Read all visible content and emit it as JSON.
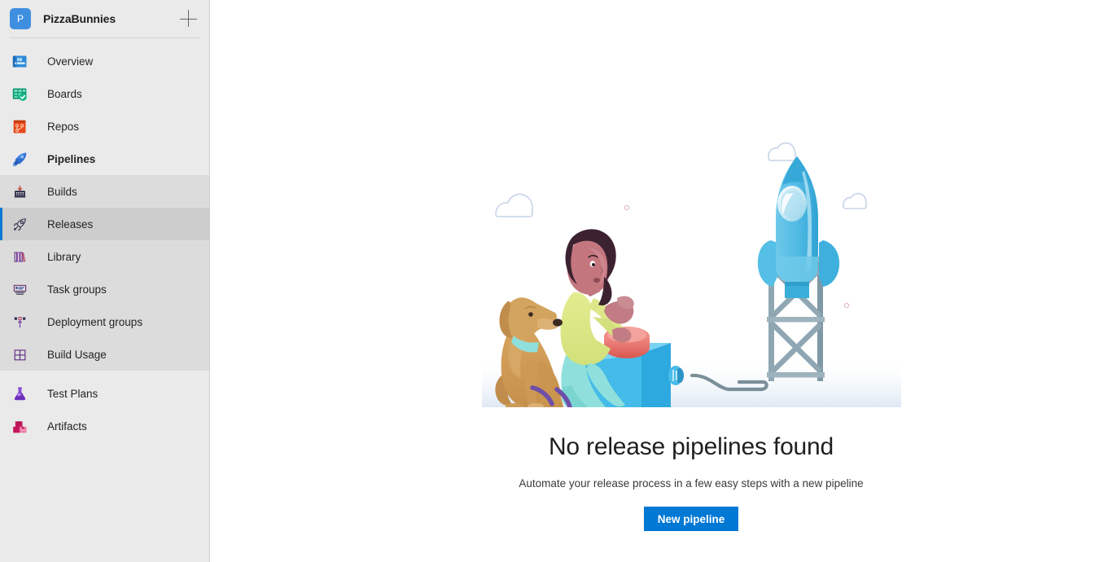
{
  "sidebar": {
    "project": {
      "avatar_letter": "P",
      "name": "PizzaBunnies",
      "add_label": "+"
    },
    "top_items": [
      {
        "label": "Overview",
        "icon": "overview-icon"
      },
      {
        "label": "Boards",
        "icon": "boards-icon"
      },
      {
        "label": "Repos",
        "icon": "repos-icon"
      },
      {
        "label": "Pipelines",
        "icon": "pipelines-icon"
      }
    ],
    "pipeline_subitems": [
      {
        "label": "Builds",
        "icon": "builds-icon"
      },
      {
        "label": "Releases",
        "icon": "releases-icon"
      },
      {
        "label": "Library",
        "icon": "library-icon"
      },
      {
        "label": "Task groups",
        "icon": "task-groups-icon"
      },
      {
        "label": "Deployment groups",
        "icon": "deployment-groups-icon"
      },
      {
        "label": "Build Usage",
        "icon": "build-usage-icon"
      }
    ],
    "bottom_items": [
      {
        "label": "Test Plans",
        "icon": "test-plans-icon"
      },
      {
        "label": "Artifacts",
        "icon": "artifacts-icon"
      }
    ],
    "selected_item": "Releases",
    "active_section": "Pipelines"
  },
  "main": {
    "illustration": "rocket-launch-illustration",
    "title": "No release pipelines found",
    "subtitle": "Automate your release process in a few easy steps with a new pipeline",
    "primary_button": "New pipeline"
  },
  "colors": {
    "accent": "#0078d4",
    "sidebar_bg": "#eaeaea",
    "submenu_bg": "#dcdcdc",
    "selected_bg": "#cdcdcd",
    "avatar_bg": "#3f8fe0"
  }
}
